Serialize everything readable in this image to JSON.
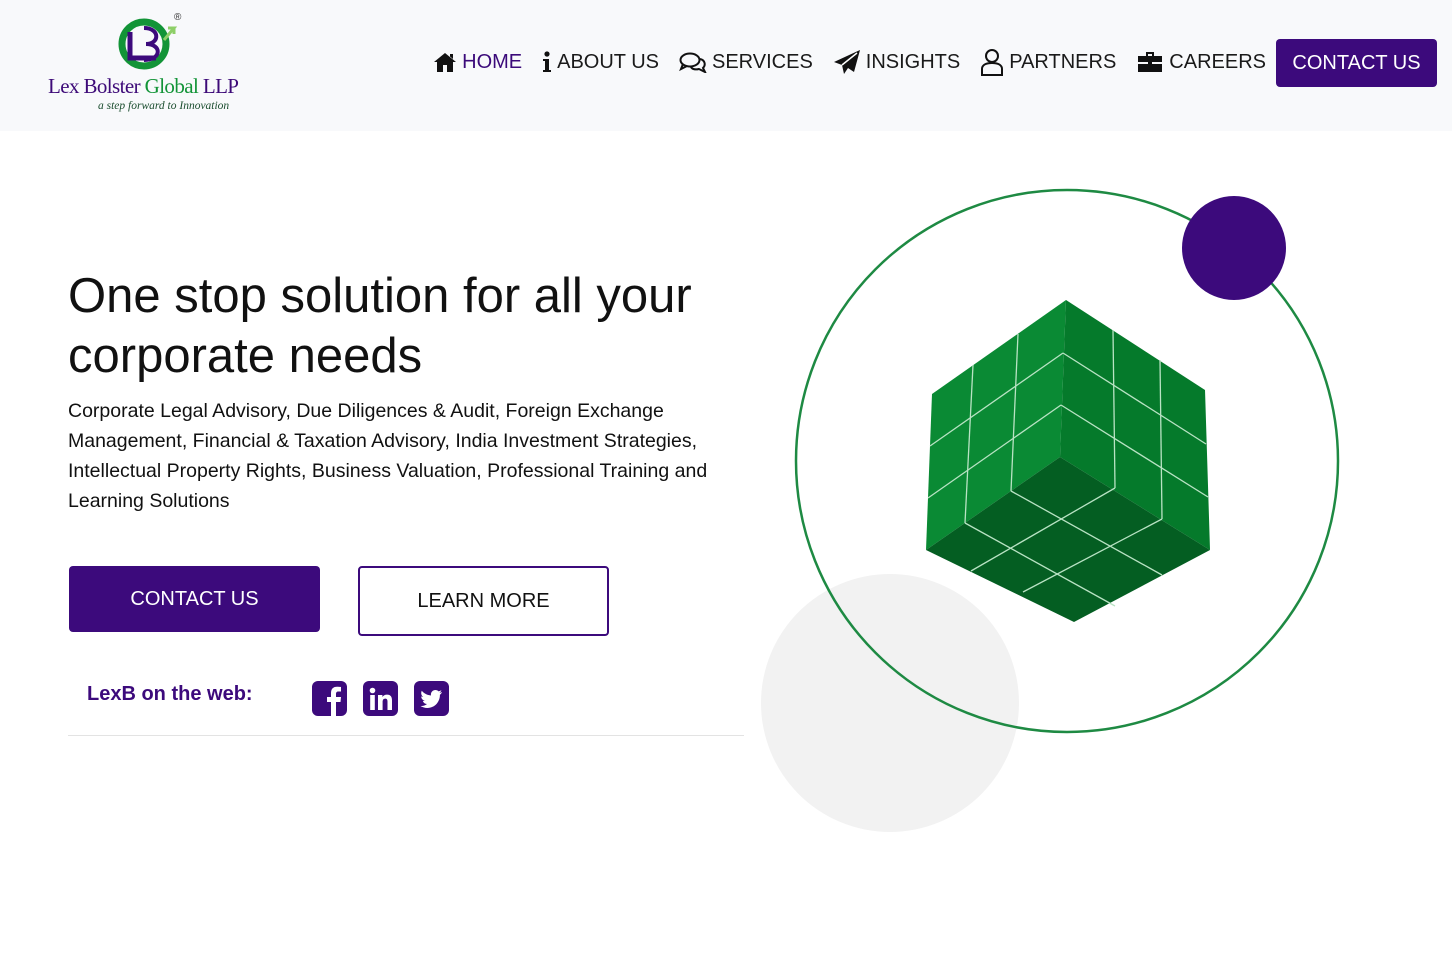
{
  "header": {
    "logo": {
      "name_part1": "Lex Bolster ",
      "name_part2": "Global",
      "name_part3": " LLP",
      "tagline": "a step forward to Innovation",
      "registered_mark": "®"
    },
    "nav": [
      {
        "label": "HOME",
        "icon": "home-icon",
        "active": true
      },
      {
        "label": "ABOUT US",
        "icon": "info-icon",
        "active": false
      },
      {
        "label": "SERVICES",
        "icon": "comments-icon",
        "active": false
      },
      {
        "label": "INSIGHTS",
        "icon": "paper-plane-icon",
        "active": false
      },
      {
        "label": "PARTNERS",
        "icon": "user-icon",
        "active": false
      },
      {
        "label": "CAREERS",
        "icon": "briefcase-icon",
        "active": false
      }
    ],
    "cta_label": "CONTACT US"
  },
  "hero": {
    "title": "One stop solution for all your corporate needs",
    "description": "Corporate Legal Advisory, Due Diligences & Audit, Foreign Exchange Management, Financial & Taxation Advisory, India Investment Strategies, Intellectual Property Rights, Business Valuation, Professional Training and Learning Solutions",
    "primary_button": "CONTACT US",
    "secondary_button": "LEARN MORE"
  },
  "social": {
    "label": "LexB on the web:",
    "links": [
      {
        "name": "facebook-icon"
      },
      {
        "name": "linkedin-icon"
      },
      {
        "name": "twitter-icon"
      }
    ]
  },
  "colors": {
    "brand_purple": "#3c0a7c",
    "brand_green": "#129437",
    "header_bg": "#f8f9fb",
    "ring_green": "#1e8a43",
    "blob_gray": "#f2f2f2"
  }
}
